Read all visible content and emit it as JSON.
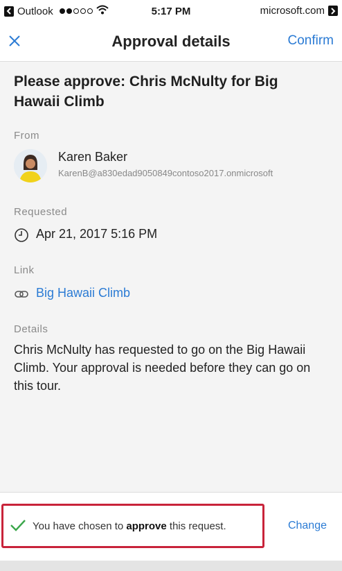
{
  "status_bar": {
    "app_name": "Outlook",
    "time": "5:17 PM",
    "site": "microsoft.com"
  },
  "header": {
    "title": "Approval details",
    "confirm_label": "Confirm"
  },
  "request": {
    "subject": "Please approve: Chris McNulty for Big Hawaii Climb",
    "from_label": "From",
    "from_name": "Karen Baker",
    "from_email": "KarenB@a830edad9050849contoso2017.onmicrosoft",
    "requested_label": "Requested",
    "requested_date": "Apr 21, 2017 5:16 PM",
    "link_label": "Link",
    "link_text": "Big Hawaii Climb",
    "details_label": "Details",
    "details_text": "Chris McNulty has requested to go on the Big Hawaii Climb. Your approval is needed before they can go on this tour."
  },
  "footer": {
    "msg_prefix": "You have chosen to ",
    "msg_bold": "approve",
    "msg_suffix": " this request.",
    "change_label": "Change"
  },
  "colors": {
    "accent": "#2b7bd4",
    "highlight": "#c8233a",
    "check": "#3aa64a"
  },
  "icons": [
    "back-arrow-icon",
    "wifi-icon",
    "forward-arrow-icon",
    "close-icon",
    "clock-icon",
    "link-icon",
    "check-icon"
  ]
}
